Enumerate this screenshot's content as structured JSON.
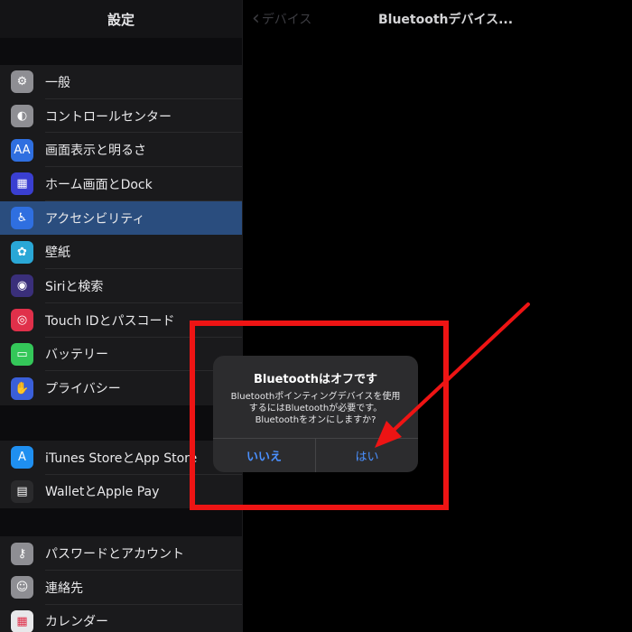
{
  "sidebar": {
    "title": "設定",
    "groups": [
      [
        {
          "label": "一般",
          "icon": "gear-icon",
          "color": "#8e8e93",
          "glyph": "⚙"
        },
        {
          "label": "コントロールセンター",
          "icon": "toggles-icon",
          "color": "#8e8e93",
          "glyph": "◐"
        },
        {
          "label": "画面表示と明るさ",
          "icon": "text-size-icon",
          "color": "#2f6fe0",
          "glyph": "AA"
        },
        {
          "label": "ホーム画面とDock",
          "icon": "home-grid-icon",
          "color": "#3a3fd1",
          "glyph": "▦"
        },
        {
          "label": "アクセシビリティ",
          "icon": "accessibility-icon",
          "color": "#2f6fe0",
          "glyph": "♿",
          "selected": true
        },
        {
          "label": "壁紙",
          "icon": "wallpaper-icon",
          "color": "#2aa7d6",
          "glyph": "✿"
        },
        {
          "label": "Siriと検索",
          "icon": "siri-icon",
          "color": "#3a2f7a",
          "glyph": "◉"
        },
        {
          "label": "Touch IDとパスコード",
          "icon": "fingerprint-icon",
          "color": "#e0304a",
          "glyph": "◎"
        },
        {
          "label": "バッテリー",
          "icon": "battery-icon",
          "color": "#34c759",
          "glyph": "▭"
        },
        {
          "label": "プライバシー",
          "icon": "hand-icon",
          "color": "#3a5fd9",
          "glyph": "✋"
        }
      ],
      [
        {
          "label": "iTunes StoreとApp Store",
          "icon": "app-store-icon",
          "color": "#1f8ff0",
          "glyph": "A"
        },
        {
          "label": "WalletとApple Pay",
          "icon": "wallet-icon",
          "color": "#2a2a2c",
          "glyph": "▤"
        }
      ],
      [
        {
          "label": "パスワードとアカウント",
          "icon": "key-icon",
          "color": "#8e8e93",
          "glyph": "⚷"
        },
        {
          "label": "連絡先",
          "icon": "contacts-icon",
          "color": "#8e8e93",
          "glyph": "☺"
        },
        {
          "label": "カレンダー",
          "icon": "calendar-icon",
          "color": "#e8e8ea",
          "glyph": "▦"
        }
      ]
    ]
  },
  "detail": {
    "back_label": "デバイス",
    "title": "Bluetoothデバイス..."
  },
  "alert": {
    "title": "Bluetoothはオフです",
    "message_lines": [
      "Bluetoothポインティングデバイスを使用",
      "するにはBluetoothが必要です。",
      "Bluetoothをオンにしますか?"
    ],
    "cancel_label": "いいえ",
    "confirm_label": "はい"
  },
  "annotation": {
    "color": "#ee1414"
  }
}
